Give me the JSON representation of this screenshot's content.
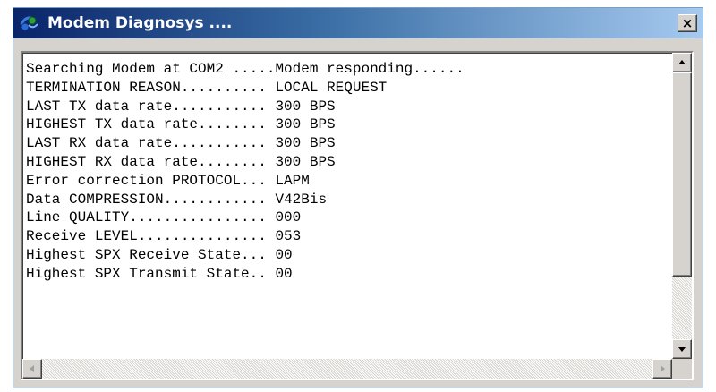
{
  "window": {
    "title": "Modem Diagnosys ....",
    "icon": "network-globe-icon",
    "close_label": "×"
  },
  "output": {
    "lines": [
      "Searching Modem at COM2 .....Modem responding......",
      "TERMINATION REASON.......... LOCAL REQUEST",
      "LAST TX data rate........... 300 BPS",
      "HIGHEST TX data rate........ 300 BPS",
      "LAST RX data rate........... 300 BPS",
      "HIGHEST RX data rate........ 300 BPS",
      "Error correction PROTOCOL... LAPM",
      "Data COMPRESSION............ V42Bis",
      "Line QUALITY................ 000",
      "Receive LEVEL............... 053",
      "Highest SPX Receive State... 00",
      "Highest SPX Transmit State.. 00"
    ]
  },
  "colors": {
    "titlebar_start": "#0a246a",
    "titlebar_end": "#a6caf0",
    "window_face": "#d6d3ce",
    "text_area_background": "#ffffff"
  }
}
